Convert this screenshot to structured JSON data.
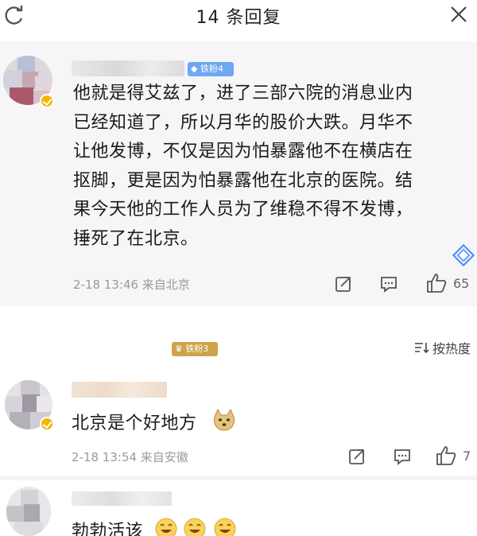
{
  "header": {
    "title": "14 条回复",
    "refresh_icon": "refresh-icon",
    "close_icon": "close-icon"
  },
  "main_comment": {
    "fan_badge": "铁粉4",
    "lines": [
      "他就是得艾兹了，进了三部六院的消息业内",
      "已经知道了，所以月华的股价大跌。月华不",
      "让他发博，不仅是因为怕暴露他不在横店在",
      "抠脚，更是因为怕暴露他在北京的医院。结",
      "果今天他的工作人员为了维稳不得不发博，",
      "捶死了在北京。"
    ],
    "meta": "2-18 13:46  来自北京",
    "like_count": "65",
    "actions": [
      "share-icon",
      "comment-icon",
      "like-icon"
    ]
  },
  "sort": {
    "label": "按热度",
    "icon": "sort-icon"
  },
  "replies": [
    {
      "fan_badge": "铁粉3",
      "text": "北京是个好地方",
      "emoji": "doge-emoji",
      "meta": "2-18 13:54  来自安徽",
      "like_count": "7"
    },
    {
      "text": "勃勃活该",
      "emojis": [
        "laugh-emoji",
        "laugh-emoji",
        "laugh-emoji"
      ]
    }
  ],
  "colors": {
    "main_bg": "#f6f6f8",
    "fan_badge_blue": "#6ea7f2",
    "fan_badge_gold": "#cfa24c",
    "meta_gray": "#9a9a9a"
  }
}
